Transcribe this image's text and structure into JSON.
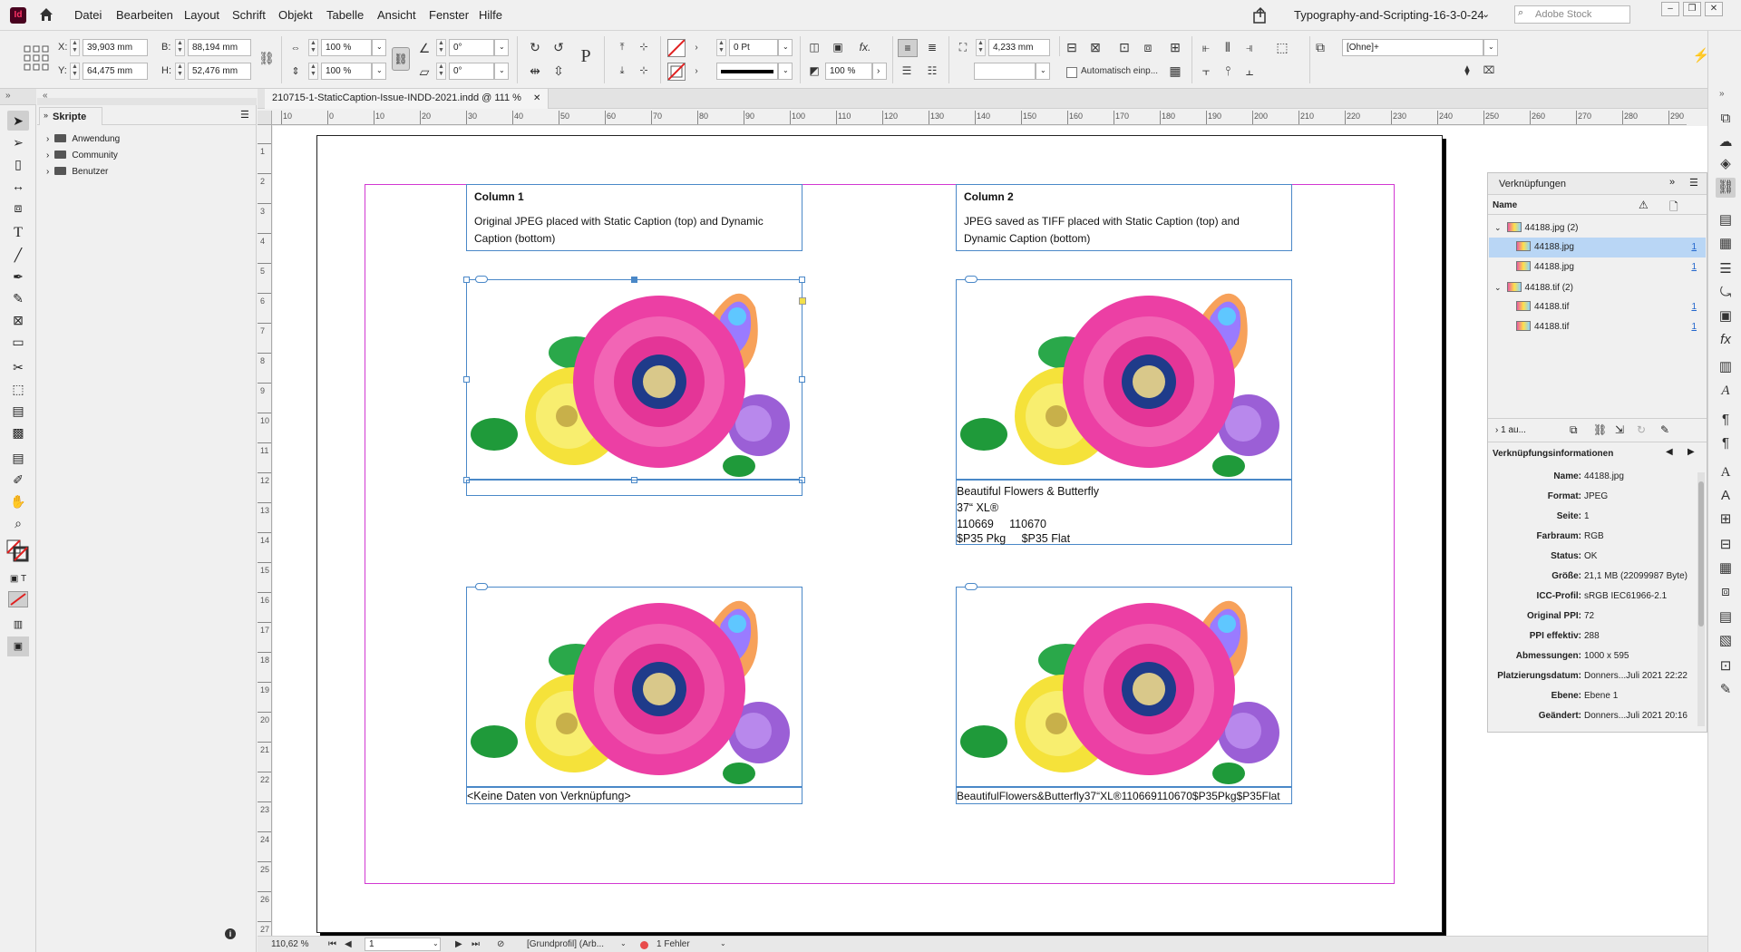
{
  "app": {
    "logo_text": "Id"
  },
  "menu": [
    "Datei",
    "Bearbeiten",
    "Layout",
    "Schrift",
    "Objekt",
    "Tabelle",
    "Ansicht",
    "Fenster",
    "Hilfe"
  ],
  "workspace": {
    "name": "Typography-and-Scripting-16-3-0-24",
    "search_placeholder": "Adobe Stock"
  },
  "control": {
    "x_label": "X:",
    "x": "39,903 mm",
    "y_label": "Y:",
    "y": "64,475 mm",
    "b_label": "B:",
    "b": "88,194 mm",
    "h_label": "H:",
    "h": "52,476 mm",
    "scale_x": "100 %",
    "scale_y": "100 %",
    "rotate": "0°",
    "shear": "0°",
    "stroke_weight": "0 Pt",
    "opacity": "100 %",
    "offset": "4,233 mm",
    "autofit": "Automatisch einp...",
    "object_style": "[Ohne]+"
  },
  "scripts_panel": {
    "title": "Skripte",
    "items": [
      "Anwendung",
      "Community",
      "Benutzer"
    ]
  },
  "document_tab": "210715-1-StaticCaption-Issue-INDD-2021.indd @ 111 %",
  "ruler_h": [
    "10",
    "0",
    "10",
    "20",
    "30",
    "40",
    "50",
    "60",
    "70",
    "80",
    "90",
    "100",
    "110",
    "120",
    "130",
    "140",
    "150",
    "160",
    "170",
    "180",
    "190",
    "200",
    "210",
    "220",
    "230",
    "240",
    "250",
    "260",
    "270",
    "280",
    "290"
  ],
  "ruler_v": [
    "1",
    "2",
    "3",
    "4",
    "5",
    "6",
    "7",
    "8",
    "9",
    "10",
    "11",
    "12",
    "13",
    "14",
    "15",
    "16",
    "17",
    "18",
    "19",
    "20",
    "21",
    "22",
    "23",
    "24",
    "25",
    "26",
    "27"
  ],
  "document": {
    "col1_heading": "Column 1",
    "col1_text": "Original JPEG placed with Static Caption (top) and Dynamic Caption (bottom)",
    "col2_heading": "Column 2",
    "col2_text": "JPEG saved as TIFF placed with Static Caption (top) and Dynamic Caption (bottom)",
    "static_caption_lines": [
      "Beautiful Flowers & Butterfly",
      "37“ XL®",
      "110669     110670",
      "$P35 Pkg     $P35 Flat"
    ],
    "dynamic_caption_jpg": "<Keine Daten von Verknüpfung>",
    "dynamic_caption_tif": "BeautifulFlowers&Butterfly37“XL®110669110670$P35Pkg$P35Flat"
  },
  "links_panel": {
    "title": "Verknüpfungen",
    "column_name": "Name",
    "rows": [
      {
        "label": "44188.jpg (2)",
        "page": ""
      },
      {
        "label": "44188.jpg",
        "page": "1"
      },
      {
        "label": "44188.jpg",
        "page": "1"
      },
      {
        "label": "44188.tif (2)",
        "page": ""
      },
      {
        "label": "44188.tif",
        "page": "1"
      },
      {
        "label": "44188.tif",
        "page": "1"
      }
    ],
    "footer_count": "1 au...",
    "info_title": "Verknüpfungsinformationen",
    "info": [
      {
        "label": "Name:",
        "value": "44188.jpg"
      },
      {
        "label": "Format:",
        "value": "JPEG"
      },
      {
        "label": "Seite:",
        "value": "1"
      },
      {
        "label": "Farbraum:",
        "value": "RGB"
      },
      {
        "label": "Status:",
        "value": "OK"
      },
      {
        "label": "Größe:",
        "value": "21,1 MB (22099987 Byte)"
      },
      {
        "label": "ICC-Profil:",
        "value": "sRGB IEC61966-2.1"
      },
      {
        "label": "Original PPI:",
        "value": "72"
      },
      {
        "label": "PPI effektiv:",
        "value": "288"
      },
      {
        "label": "Abmessungen:",
        "value": "1000 x 595"
      },
      {
        "label": "Platzierungsdatum:",
        "value": "Donners...Juli 2021 22:22"
      },
      {
        "label": "Ebene:",
        "value": "Ebene 1"
      },
      {
        "label": "Geändert:",
        "value": "Donners...Juli 2021 20:16"
      }
    ]
  },
  "status": {
    "zoom": "110,62 %",
    "page": "1",
    "profile": "[Grundprofil] (Arb...",
    "errors": "1 Fehler"
  },
  "colors": {
    "margin": "#d238d2",
    "frame": "#4a88c8",
    "error": "#e84b4b",
    "selected_row": "#b9d6f5"
  }
}
